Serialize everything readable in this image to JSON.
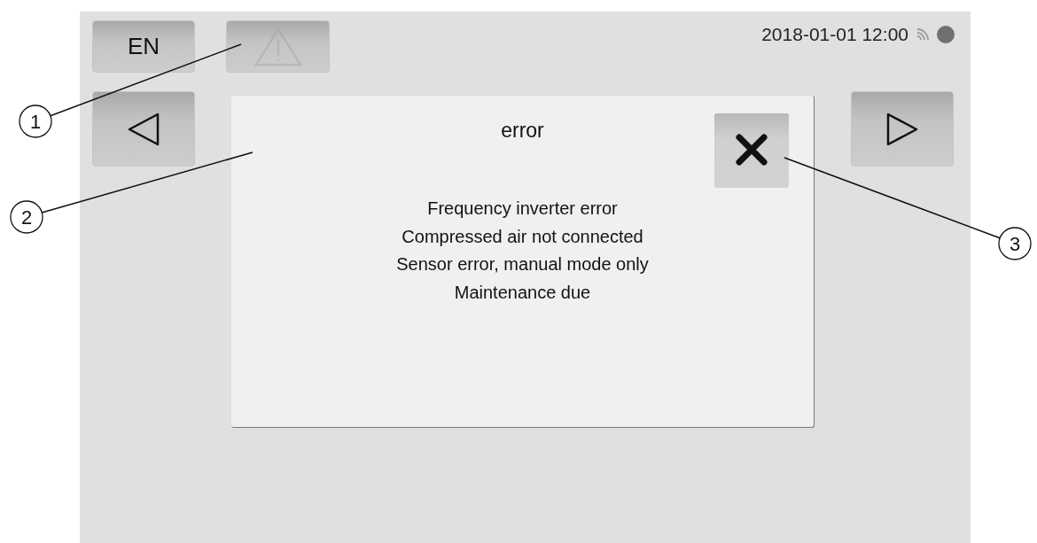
{
  "top_bar": {
    "language_button": "EN",
    "warning_button": {
      "disabled": true
    },
    "datetime": "2018-01-01 12:00"
  },
  "dialog": {
    "title": "error",
    "messages": [
      "Frequency inverter error",
      "Compressed air not connected",
      "Sensor error, manual mode only",
      "Maintenance due"
    ]
  },
  "callouts": [
    {
      "number": "1"
    },
    {
      "number": "2"
    },
    {
      "number": "3"
    }
  ]
}
